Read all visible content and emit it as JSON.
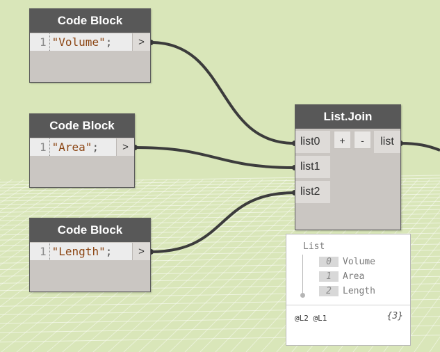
{
  "code_blocks": [
    {
      "title": "Code Block",
      "line": "1",
      "string": "\"Volume\"",
      "punct": ";",
      "port": ">"
    },
    {
      "title": "Code Block",
      "line": "1",
      "string": "\"Area\"",
      "punct": ";",
      "port": ">"
    },
    {
      "title": "Code Block",
      "line": "1",
      "string": "\"Length\"",
      "punct": ";",
      "port": ">"
    }
  ],
  "list_join": {
    "title": "List.Join",
    "inputs": [
      "list0",
      "list1",
      "list2"
    ],
    "add_label": "+",
    "remove_label": "-",
    "output": "list"
  },
  "preview": {
    "title": "List",
    "items": [
      {
        "index": "0",
        "value": "Volume"
      },
      {
        "index": "1",
        "value": "Area"
      },
      {
        "index": "2",
        "value": "Length"
      }
    ],
    "levels": "@L2 @L1",
    "count": "{3}"
  },
  "colors": {
    "background": "#d9e6b9",
    "node_header": "#585858",
    "node_body": "#cac6c2",
    "wire": "#3c3c3c",
    "string_literal": "#8b4513"
  }
}
